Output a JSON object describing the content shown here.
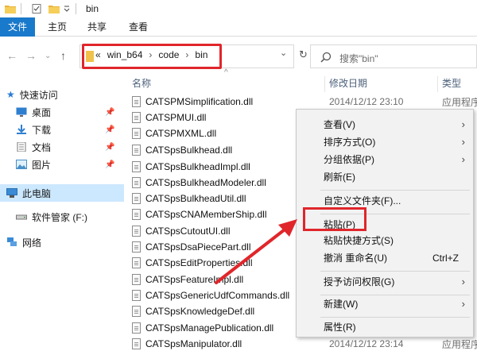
{
  "window": {
    "title": "bin"
  },
  "ribbon": {
    "tabs": [
      {
        "label": "文件"
      },
      {
        "label": "主页"
      },
      {
        "label": "共享"
      },
      {
        "label": "查看"
      }
    ]
  },
  "address": {
    "crumbs": [
      "«",
      "win_b64",
      "›",
      "code",
      "›",
      "bin"
    ]
  },
  "search": {
    "placeholder": "搜索\"bin\""
  },
  "nav": {
    "quick_access": "快速访问",
    "items": [
      {
        "label": "桌面",
        "pinned": true
      },
      {
        "label": "下载",
        "pinned": true
      },
      {
        "label": "文档",
        "pinned": true
      },
      {
        "label": "图片",
        "pinned": true
      }
    ],
    "this_pc": "此电脑",
    "drive": "软件管家 (F:)",
    "network": "网络"
  },
  "columns": {
    "name": "名称",
    "date": "修改日期",
    "type": "类型"
  },
  "files": [
    {
      "name": "CATSPMSimplification.dll",
      "date": "2014/12/12 23:10",
      "type": "应用程序"
    },
    {
      "name": "CATSPMUI.dll",
      "date": "",
      "type": ""
    },
    {
      "name": "CATSPMXML.dll",
      "date": "",
      "type": ""
    },
    {
      "name": "CATSpsBulkhead.dll",
      "date": "",
      "type": ""
    },
    {
      "name": "CATSpsBulkheadImpl.dll",
      "date": "",
      "type": ""
    },
    {
      "name": "CATSpsBulkheadModeler.dll",
      "date": "",
      "type": ""
    },
    {
      "name": "CATSpsBulkheadUtil.dll",
      "date": "",
      "type": ""
    },
    {
      "name": "CATSpsCNAMemberShip.dll",
      "date": "",
      "type": ""
    },
    {
      "name": "CATSpsCutoutUI.dll",
      "date": "",
      "type": ""
    },
    {
      "name": "CATSpsDsaPiecePart.dll",
      "date": "",
      "type": ""
    },
    {
      "name": "CATSpsEditProperties.dll",
      "date": "",
      "type": ""
    },
    {
      "name": "CATSpsFeatureImpl.dll",
      "date": "",
      "type": ""
    },
    {
      "name": "CATSpsGenericUdfCommands.dll",
      "date": "",
      "type": ""
    },
    {
      "name": "CATSpsKnowledgeDef.dll",
      "date": "",
      "type": ""
    },
    {
      "name": "CATSpsManagePublication.dll",
      "date": "",
      "type": ""
    },
    {
      "name": "CATSpsManipulator.dll",
      "date": "2014/12/12 23:14",
      "type": "应用程序"
    }
  ],
  "context_menu": {
    "view": "查看(V)",
    "sort": "排序方式(O)",
    "group": "分组依据(P)",
    "refresh": "刷新(E)",
    "customize": "自定义文件夹(F)...",
    "paste": "粘贴(P)",
    "paste_shortcut": "粘贴快捷方式(S)",
    "undo": "撤消 重命名(U)",
    "undo_shortcut": "Ctrl+Z",
    "grant": "授予访问权限(G)",
    "new": "新建(W)",
    "properties": "属性(R)"
  },
  "colors": {
    "accent": "#1979ca",
    "highlight": "#e0262b",
    "selection": "#cce8ff"
  }
}
